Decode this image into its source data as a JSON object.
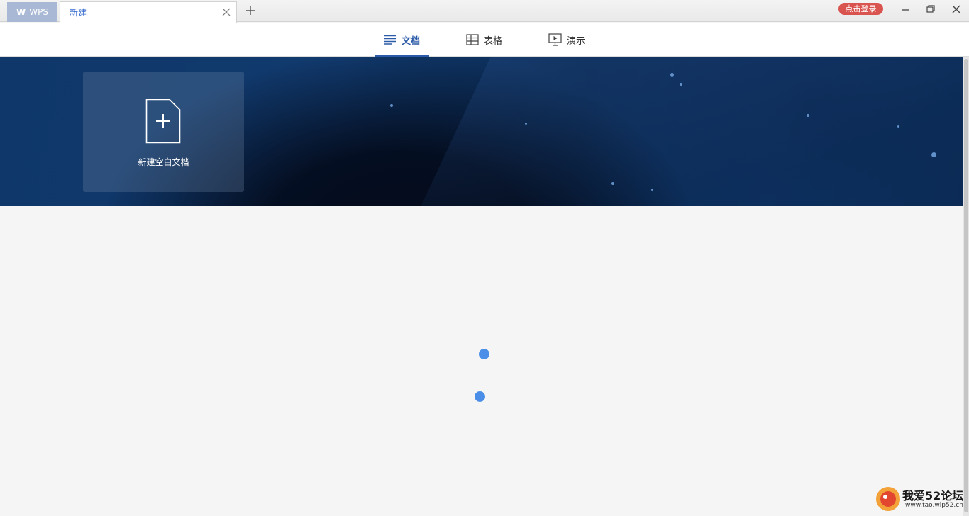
{
  "titlebar": {
    "app_tab_label": "WPS",
    "document_tab_label": "新建",
    "login_badge": "点击登录"
  },
  "category_nav": {
    "items": [
      {
        "label": "文档",
        "icon": "document-lines-icon",
        "active": true
      },
      {
        "label": "表格",
        "icon": "table-grid-icon",
        "active": false
      },
      {
        "label": "演示",
        "icon": "presentation-icon",
        "active": false
      }
    ]
  },
  "banner": {
    "new_card_label": "新建空白文档"
  },
  "watermark": {
    "main": "我爱52论坛",
    "sub": "www.tao.wip52.cn"
  },
  "colors": {
    "accent": "#2b5aa8",
    "login_badge": "#d9534f",
    "spinner": "#4a8ee8",
    "banner_base": "#0f3769"
  }
}
